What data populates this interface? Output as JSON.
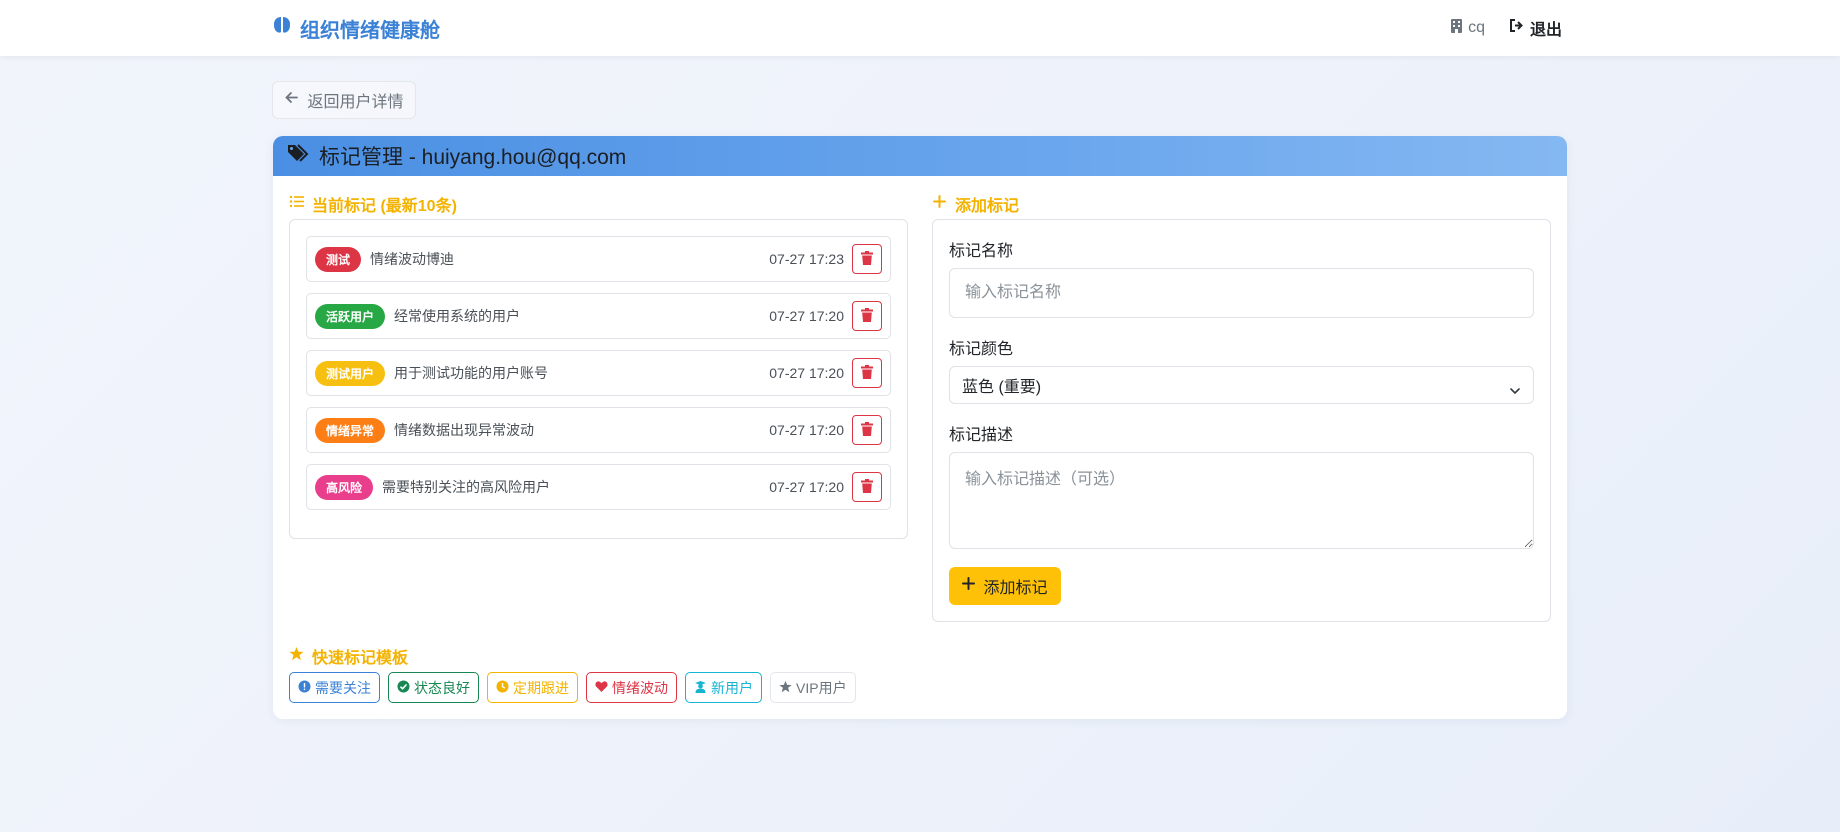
{
  "navbar": {
    "brand": "组织情绪健康舱",
    "brand_icon": "brain-icon",
    "org": "cq",
    "org_icon": "building-icon",
    "logout": "退出",
    "logout_icon": "sign-out-icon"
  },
  "back_button": {
    "label": "返回用户详情",
    "icon": "arrow-left-icon"
  },
  "card": {
    "title": "标记管理 - huiyang.hou@qq.com",
    "title_icon": "tags-icon"
  },
  "current_tags": {
    "title": "当前标记 (最新10条)",
    "items": [
      {
        "name": "测试",
        "color": "#dc3545",
        "desc": "情绪波动博迪",
        "time": "07-27 17:23"
      },
      {
        "name": "活跃用户",
        "color": "#28a745",
        "desc": "经常使用系统的用户",
        "time": "07-27 17:20"
      },
      {
        "name": "测试用户",
        "color": "#f7c010",
        "desc": "用于测试功能的用户账号",
        "time": "07-27 17:20"
      },
      {
        "name": "情绪异常",
        "color": "#fd7e14",
        "desc": "情绪数据出现异常波动",
        "time": "07-27 17:20"
      },
      {
        "name": "高风险",
        "color": "#e83e8c",
        "desc": "需要特别关注的高风险用户",
        "time": "07-27 17:20"
      }
    ]
  },
  "add_form": {
    "title": "添加标记",
    "name_label": "标记名称",
    "name_placeholder": "输入标记名称",
    "name_value": "",
    "color_label": "标记颜色",
    "color_value": "蓝色 (重要)",
    "desc_label": "标记描述",
    "desc_placeholder": "输入标记描述（可选）",
    "desc_value": "",
    "submit": "添加标记"
  },
  "templates": {
    "title": "快速标记模板",
    "items": [
      {
        "label": "需要关注",
        "color": "#3b82d6",
        "icon": "exclamation-circle-icon"
      },
      {
        "label": "状态良好",
        "color": "#198754",
        "icon": "check-circle-icon"
      },
      {
        "label": "定期跟进",
        "color": "#f3b300",
        "icon": "clock-icon"
      },
      {
        "label": "情绪波动",
        "color": "#dc3545",
        "icon": "heart-icon"
      },
      {
        "label": "新用户",
        "color": "#17b4d2",
        "icon": "user-graduate-icon"
      },
      {
        "label": "VIP用户",
        "color": "#6c757d",
        "icon": "star-icon"
      }
    ]
  }
}
